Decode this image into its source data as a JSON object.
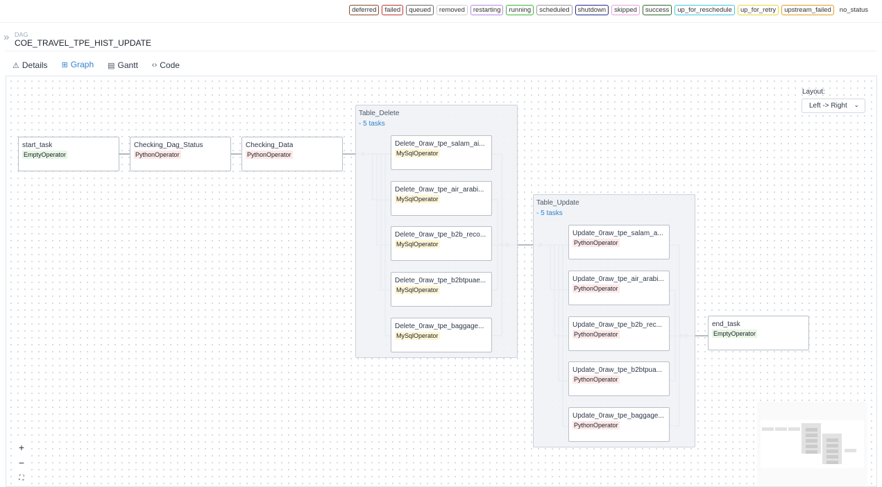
{
  "legend": {
    "items": [
      {
        "label": "deferred",
        "color": "#8a4a2c"
      },
      {
        "label": "failed",
        "color": "#c53030"
      },
      {
        "label": "queued",
        "color": "#6b6b6b"
      },
      {
        "label": "removed",
        "color": "#cfcfcf"
      },
      {
        "label": "restarting",
        "color": "#b388e6"
      },
      {
        "label": "running",
        "color": "#38b832"
      },
      {
        "label": "scheduled",
        "color": "#9a9a9a"
      },
      {
        "label": "shutdown",
        "color": "#1f2a8c"
      },
      {
        "label": "skipped",
        "color": "#e4a2d8"
      },
      {
        "label": "success",
        "color": "#2f6b2a"
      },
      {
        "label": "up_for_reschedule",
        "color": "#40c8de"
      },
      {
        "label": "up_for_retry",
        "color": "#e6d63a"
      },
      {
        "label": "upstream_failed",
        "color": "#e0a020"
      },
      {
        "label": "no_status",
        "color": "transparent"
      }
    ]
  },
  "dag": {
    "label": "DAG",
    "id": "COE_TRAVEL_TPE_HIST_UPDATE"
  },
  "tabs": [
    {
      "label": "Details",
      "icon": "warning-triangle-icon",
      "glyph": "⚠"
    },
    {
      "label": "Graph",
      "icon": "graph-icon",
      "glyph": "⊞"
    },
    {
      "label": "Gantt",
      "icon": "gantt-icon",
      "glyph": "▤"
    },
    {
      "label": "Code",
      "icon": "code-icon",
      "glyph": "‹›"
    }
  ],
  "active_tab": "Graph",
  "layout": {
    "label": "Layout:",
    "value": "Left -> Right",
    "caret": "⌄"
  },
  "graph": {
    "nodes": {
      "start": {
        "id": "start_task",
        "op": "EmptyOperator"
      },
      "check_status": {
        "id": "Checking_Dag_Status",
        "op": "PythonOperator"
      },
      "check_data": {
        "id": "Checking_Data",
        "op": "PythonOperator"
      },
      "end": {
        "id": "end_task",
        "op": "EmptyOperator"
      }
    },
    "groups": {
      "delete": {
        "name": "Table_Delete",
        "count": "- 5 tasks",
        "tasks": [
          {
            "id": "Delete_0raw_tpe_salam_ai...",
            "op": "MySqlOperator"
          },
          {
            "id": "Delete_0raw_tpe_air_arabi...",
            "op": "MySqlOperator"
          },
          {
            "id": "Delete_0raw_tpe_b2b_reco...",
            "op": "MySqlOperator"
          },
          {
            "id": "Delete_0raw_tpe_b2btpuae...",
            "op": "MySqlOperator"
          },
          {
            "id": "Delete_0raw_tpe_baggage...",
            "op": "MySqlOperator"
          }
        ]
      },
      "update": {
        "name": "Table_Update",
        "count": "- 5 tasks",
        "tasks": [
          {
            "id": "Update_0raw_tpe_salam_a...",
            "op": "PythonOperator"
          },
          {
            "id": "Update_0raw_tpe_air_arabi...",
            "op": "PythonOperator"
          },
          {
            "id": "Update_0raw_tpe_b2b_rec...",
            "op": "PythonOperator"
          },
          {
            "id": "Update_0raw_tpe_b2btpua...",
            "op": "PythonOperator"
          },
          {
            "id": "Update_0raw_tpe_baggage...",
            "op": "PythonOperator"
          }
        ]
      }
    }
  },
  "controls": {
    "zoom_in": "+",
    "zoom_out": "−",
    "fit": "⛶"
  }
}
